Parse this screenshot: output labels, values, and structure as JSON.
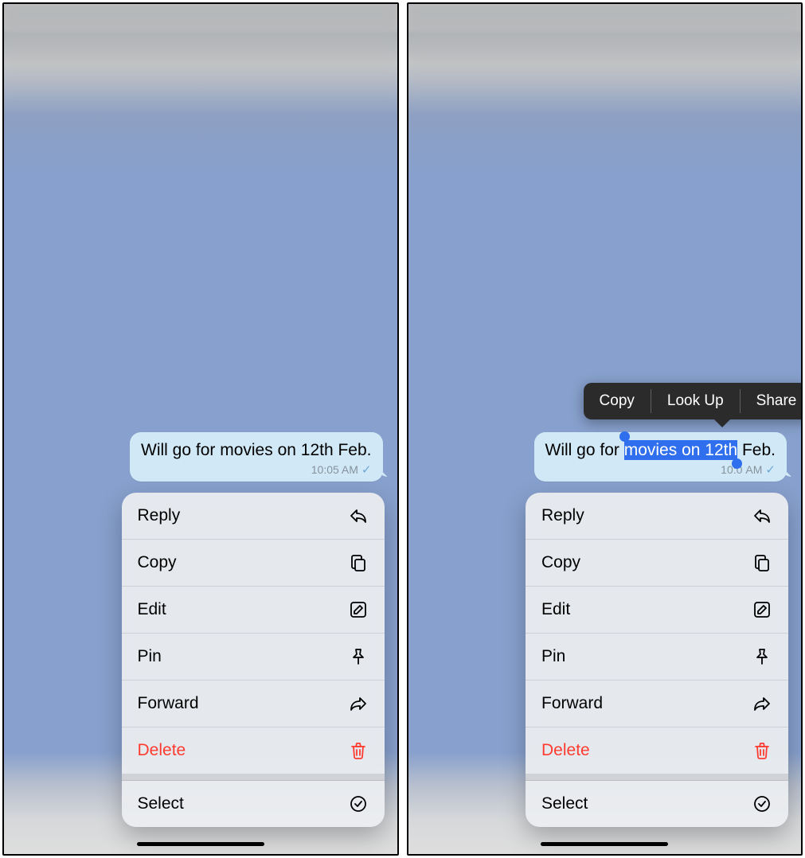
{
  "left": {
    "bubble": {
      "text_before": "Will go for movies on 12th Feb.",
      "time": "10:05 AM"
    },
    "menu": {
      "reply": "Reply",
      "copy": "Copy",
      "edit": "Edit",
      "pin": "Pin",
      "forward": "Forward",
      "delete": "Delete",
      "select": "Select"
    }
  },
  "right": {
    "bubble": {
      "pre": "Will go for ",
      "sel": "movies on 12th",
      "post": " Feb.",
      "time_pre": "10:0",
      "time_post": " AM"
    },
    "popover": {
      "copy": "Copy",
      "lookup": "Look Up",
      "share": "Share"
    },
    "menu": {
      "reply": "Reply",
      "copy": "Copy",
      "edit": "Edit",
      "pin": "Pin",
      "forward": "Forward",
      "delete": "Delete",
      "select": "Select"
    }
  },
  "colors": {
    "accent": "#2f6fed",
    "danger": "#ff3b30",
    "bubble": "#d1e9f7"
  }
}
